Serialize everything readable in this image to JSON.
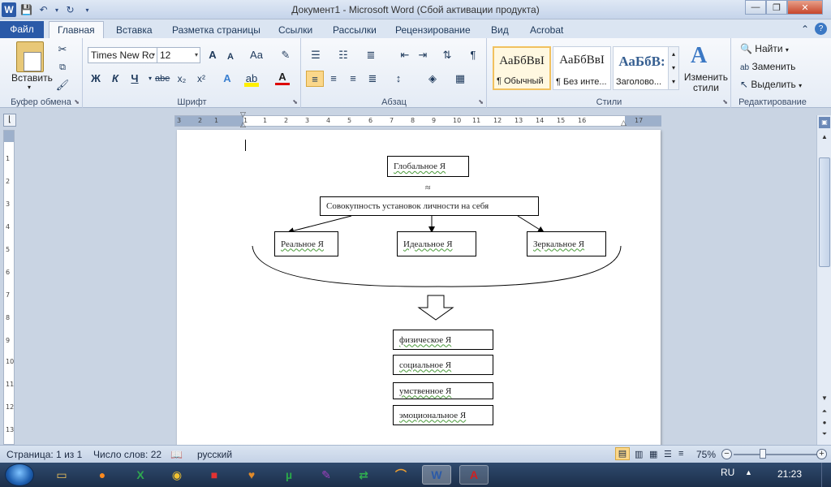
{
  "window": {
    "title": "Документ1  -  Microsoft Word (Сбой активации продукта)",
    "minimize": "—",
    "maximize": "❐",
    "close": "✕"
  },
  "qat": {
    "logo": "W",
    "save": "💾",
    "undo": "↶",
    "undo_arrow": "▾",
    "redo": "↻",
    "customize": "▾"
  },
  "tabs": [
    "Файл",
    "Главная",
    "Вставка",
    "Разметка страницы",
    "Ссылки",
    "Рассылки",
    "Рецензирование",
    "Вид",
    "Acrobat"
  ],
  "active_tab": "Главная",
  "ribbon": {
    "clipboard": {
      "label": "Буфер обмена",
      "paste": "Вставить"
    },
    "font": {
      "label": "Шрифт",
      "name": "Times New Rc",
      "size": "12",
      "bold": "Ж",
      "italic": "К",
      "underline": "Ч",
      "strike": "abe",
      "sub": "x₂",
      "sup": "x²",
      "grow": "A",
      "shrink": "A",
      "case": "Aa",
      "clear": "✎"
    },
    "paragraph": {
      "label": "Абзац",
      "pilcrow": "¶"
    },
    "styles": {
      "label": "Стили",
      "items": [
        {
          "sample": "АаБбВвІ",
          "name": "¶ Обычный"
        },
        {
          "sample": "АаБбВвІ",
          "name": "¶ Без инте..."
        },
        {
          "sample": "АаБбВ:",
          "name": "Заголово..."
        }
      ],
      "change": "Изменить стили"
    },
    "editing": {
      "label": "Редактирование",
      "find": "Найти",
      "replace": "Заменить",
      "select": "Выделить"
    }
  },
  "ruler": {
    "ticks": [
      "3",
      "1",
      "2",
      "1",
      "1",
      "2",
      "3",
      "4",
      "5",
      "6",
      "7",
      "8",
      "9",
      "10",
      "11",
      "12",
      "13",
      "14",
      "15",
      "16",
      "17"
    ]
  },
  "document": {
    "global_self": "Глобальное Я",
    "approx": "≈",
    "totality": "Совокупность установок личности на себя",
    "real": "Реальное Я",
    "ideal": "Идеальное Я",
    "mirror": "Зеркальное Я",
    "list": [
      "физическое Я",
      "социальное Я",
      "умственное Я",
      "эмоциональное Я"
    ]
  },
  "status": {
    "page": "Страница: 1 из 1",
    "words": "Число слов: 22",
    "language": "русский",
    "zoom": "75%"
  },
  "taskbar": {
    "tray_lang": "RU",
    "time": "21:23"
  }
}
